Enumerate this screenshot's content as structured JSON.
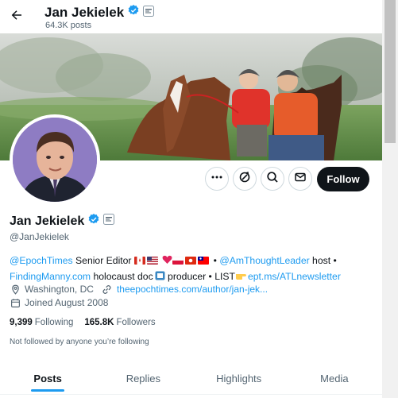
{
  "header": {
    "name": "Jan Jekielek",
    "posts": "64.3K posts"
  },
  "profile": {
    "name": "Jan Jekielek",
    "handle": "@JanJekielek",
    "follow_label": "Follow"
  },
  "bio": {
    "epoch_link": "@EpochTimes",
    "role": " Senior Editor ",
    "sep1": " • ",
    "am_link": "@AmThoughtLeader",
    "host": " host •",
    "manny_link": "FindingManny.com",
    "doc": " holocaust doc",
    "producer": " producer • LIST",
    "list_link": "ept.ms/ATLnewsletter"
  },
  "meta": {
    "location": "Washington, DC",
    "website": "theepochtimes.com/author/jan-jek...",
    "joined": "Joined August 2008"
  },
  "stats": {
    "following_count": "9,399",
    "following_label": "Following",
    "followers_count": "165.8K",
    "followers_label": "Followers"
  },
  "not_followed": "Not followed by anyone you’re following",
  "tabs": {
    "posts": "Posts",
    "replies": "Replies",
    "highlights": "Highlights",
    "media": "Media"
  },
  "colors": {
    "accent": "#1d9bf0",
    "text": "#0f1419",
    "muted": "#536471"
  },
  "icons": [
    "back-arrow-icon",
    "verified-badge-icon",
    "affiliate-badge-icon",
    "more-icon",
    "subscribe-icon",
    "search-icon",
    "message-icon",
    "location-icon",
    "link-icon",
    "calendar-icon"
  ]
}
